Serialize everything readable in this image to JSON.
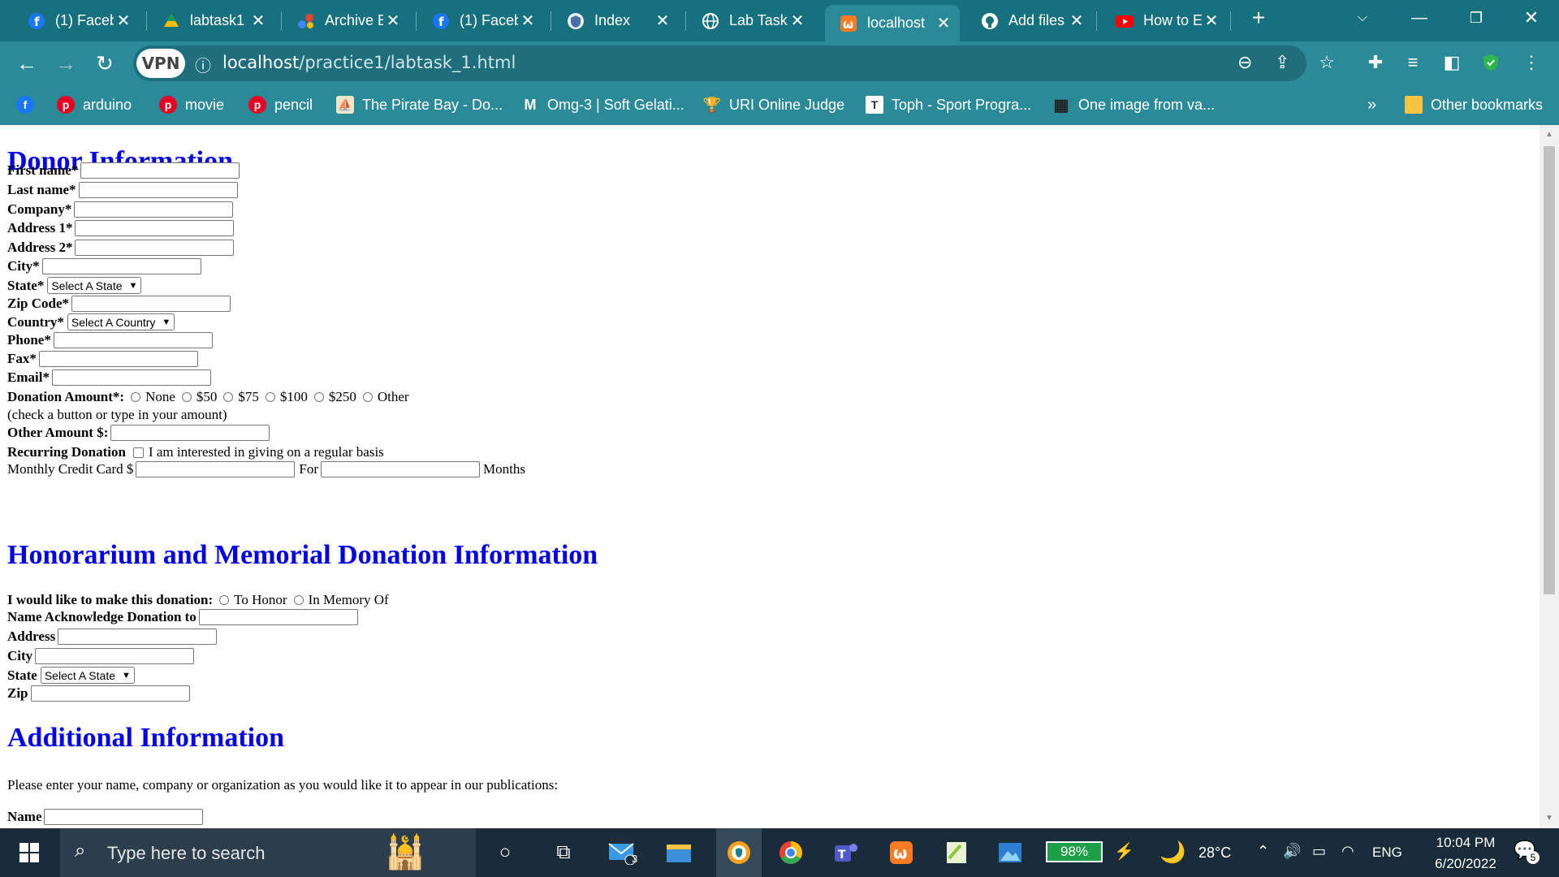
{
  "tabs": [
    {
      "title": "(1) Faceb",
      "icon": "facebook-icon"
    },
    {
      "title": "labtask1",
      "icon": "google-drive-icon"
    },
    {
      "title": "Archive E",
      "icon": "archive-icon"
    },
    {
      "title": "(1) Faceb",
      "icon": "facebook-icon"
    },
    {
      "title": "Index",
      "icon": "shield-icon"
    },
    {
      "title": "Lab Task",
      "icon": "globe-icon"
    },
    {
      "title": "localhost",
      "icon": "xampp-icon"
    },
    {
      "title": "Add files",
      "icon": "github-icon"
    },
    {
      "title": "How to E",
      "icon": "youtube-icon"
    }
  ],
  "toolbar": {
    "vpn_label": "VPN",
    "url_host": "localhost",
    "url_path": "/practice1/labtask_1.html"
  },
  "bookmarks": [
    {
      "label": "",
      "icon": "facebook-icon"
    },
    {
      "label": "arduino",
      "icon": "pinterest-icon"
    },
    {
      "label": "movie",
      "icon": "pinterest-icon"
    },
    {
      "label": "pencil",
      "icon": "pinterest-icon"
    },
    {
      "label": "The Pirate Bay - Do...",
      "icon": "pirate-ship-icon"
    },
    {
      "label": "Omg-3 | Soft Gelati...",
      "icon": "m-logo-icon"
    },
    {
      "label": "URI Online Judge",
      "icon": "trophy-icon"
    },
    {
      "label": "Toph - Sport Progra...",
      "icon": "toph-icon"
    },
    {
      "label": "One image from va...",
      "icon": "grid-icon"
    }
  ],
  "bookmarks_overflow": "»",
  "other_bookmarks": "Other bookmarks",
  "form": {
    "donor_heading": "Donor Information",
    "first_name": "First name*",
    "last_name": "Last name*",
    "company": "Company*",
    "address1": "Address 1*",
    "address2": "Address 2*",
    "city": "City*",
    "state": "State*",
    "state_select": "Select A State",
    "zip": "Zip Code*",
    "country": "Country*",
    "country_select": "Select A Country",
    "phone": "Phone*",
    "fax": "Fax*",
    "email": "Email*",
    "donation_amount": "Donation Amount*:",
    "amount_options": [
      "None",
      "$50",
      "$75",
      "$100",
      "$250",
      "Other"
    ],
    "check_note": "(check a button or type in your amount)",
    "other_amount": "Other Amount $:",
    "recurring": "Recurring Donation",
    "recurring_check": "I am interested in giving on a regular basis",
    "monthly_cc": "Monthly Credit Card $",
    "for_label": "For",
    "months": "Months",
    "honorarium_heading": "Honorarium and Memorial Donation Information",
    "make_donation": "I would like to make this donation:",
    "honor_options": [
      "To Honor",
      "In Memory Of"
    ],
    "name_ack": "Name Acknowledge Donation to",
    "h_address": "Address",
    "h_city": "City",
    "h_state": "State",
    "h_state_select": "Select A State",
    "h_zip": "Zip",
    "additional_heading": "Additional Information",
    "additional_note": "Please enter your name, company or organization as you would like it to appear in our publications:",
    "a_name": "Name"
  },
  "taskbar": {
    "search_placeholder": "Type here to search",
    "mail_badge": "3",
    "battery": "98%",
    "temperature": "28°C",
    "language": "ENG",
    "time": "10:04 PM",
    "date": "6/20/2022",
    "notification_count": "5"
  },
  "colors": {
    "chrome": "#2a8a98",
    "heading": "#0000ee",
    "taskbar": "#1a2c3a"
  }
}
